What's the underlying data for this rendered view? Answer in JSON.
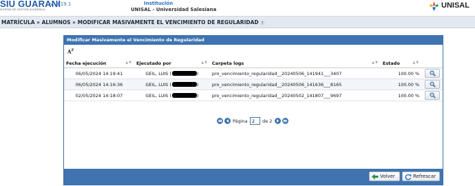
{
  "header": {
    "brand": "SIU GUARANI",
    "version": "v. 3.19.1",
    "subtitle": "SISTEMA DE GESTIÓN ACADÉMICA",
    "institution_label": "Institución",
    "institution_name": "UNISAL - Universidad Salesiana",
    "logo_right": "UNISAL"
  },
  "breadcrumb": {
    "text": "MATRÍCULA » ALUMNOS » MODIFICAR MASIVAMENTE EL VENCIMIENTO DE REGULARIDAD"
  },
  "panel": {
    "title": "Modificar Masivamente el Vencimiento de Regularidad",
    "sort_icon": "az-sort-icon",
    "columns": [
      "Fecha ejecución",
      "Ejecutado por",
      "Carpeta logs",
      "Estado"
    ],
    "rows": [
      {
        "fecha": "06/05/2024 14:19:41",
        "ejecutado": "GEIL, LUIS (",
        "carpeta": "pro_vencimiento_regularidad__20240506_141941___3407",
        "estado": "100.00 %"
      },
      {
        "fecha": "06/05/2024 14:16:36",
        "ejecutado": "GEIL, LUIS (",
        "carpeta": "pro_vencimiento_regularidad__20240506_141636___8165",
        "estado": "100.00 %"
      },
      {
        "fecha": "02/05/2024 14:18:07",
        "ejecutado": "GEIL, LUIS (",
        "carpeta": "pro_vencimiento_regularidad__20240502_141807___9697",
        "estado": "100.00 %"
      }
    ]
  },
  "pager": {
    "page_label": "Página",
    "current_page": "2",
    "of_label": "de 2"
  },
  "footer": {
    "back_label": "Volver",
    "refresh_label": "Refrescar"
  },
  "colors": {
    "accent": "#3f74b0",
    "breadcrumb_bg": "#e4e8ef",
    "brand": "#1f5aa6"
  }
}
